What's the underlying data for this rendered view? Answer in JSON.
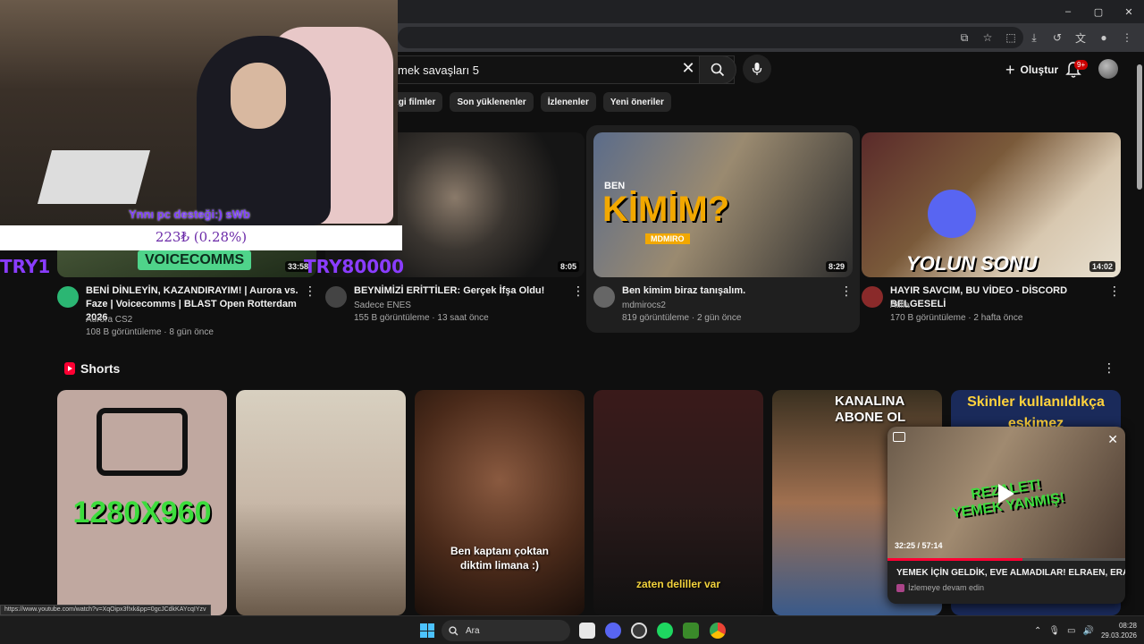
{
  "window": {
    "controls": [
      "–",
      "▢",
      "✕"
    ]
  },
  "search": {
    "query": "mek savaşları 5",
    "clear": "✕"
  },
  "header": {
    "create_label": "Oluştur",
    "notif_count": "9+"
  },
  "chips": [
    "izgi filmler",
    "Son yüklenenler",
    "İzlenenler",
    "Yeni öneriler"
  ],
  "videos": [
    {
      "duration": "33:58",
      "title": "BENİ DİNLEYİN, KAZANDIRAYIM! | Aurora vs. Faze | Voicecomms | BLAST Open Rotterdam 2026",
      "channel": "Aurora CS2",
      "stats": "108 B görüntüleme · 8 gün önce",
      "thumb_text": "VOICECOMMS"
    },
    {
      "duration": "8:05",
      "title": "BEYNİMİZİ ERİTTİLER: Gerçek İfşa Oldu!",
      "channel": "Sadece ENES",
      "stats": "155 B görüntüleme · 13 saat önce"
    },
    {
      "duration": "8:29",
      "title": "Ben kimim biraz tanışalım.",
      "channel": "mdmirocs2",
      "stats": "819 görüntüleme · 2 gün önce",
      "thumb_big": "KİMİM?",
      "thumb_small": "BEN",
      "thumb_tag": "MDMIRO"
    },
    {
      "duration": "14:02",
      "title": "HAYIR SAVCIM, BU VİDEO - DİSCORD BELGESELİ",
      "channel": "Atilla",
      "stats": "170 B görüntüleme · 2 hafta önce",
      "thumb_text": "YOLUN SONU"
    }
  ],
  "shorts": {
    "title": "Shorts",
    "items": [
      {
        "caption": "1280X960"
      },
      {
        "caption": ""
      },
      {
        "caption": "Ben kaptanı çoktan diktim limana :)"
      },
      {
        "caption": "zaten deliller var"
      },
      {
        "caption": "KANALINA ABONE OL"
      },
      {
        "caption": "Skinler kullanıldıkça eskimez"
      }
    ]
  },
  "overlay": {
    "donation_msg": "Ynnı pc desteği:) sWb",
    "donation_amount": "223₺ (0.28%)",
    "left_text": "TRY1",
    "right_text": "TRY80000"
  },
  "miniplayer": {
    "time": "32:25 / 57:14",
    "progress": 0.566,
    "title": "YEMEK İÇİN GELDİK, EVE ALMADILAR! ELRAEN, ERAY, Lİ...",
    "subtitle": "İzlemeye devam edin",
    "thumb_text": "REZALET! YEMEK YANMIŞ!"
  },
  "status_url": "https://www.youtube.com/watch?v=XqOipx3f!xk&pp=0gcJCdkKAYcqIYzv",
  "taskbar": {
    "search_label": "Ara",
    "time": "08:28",
    "date": "29.03.2026"
  },
  "colors": {
    "accent": "#ff0033",
    "overlay_purple": "#8a3cff"
  }
}
